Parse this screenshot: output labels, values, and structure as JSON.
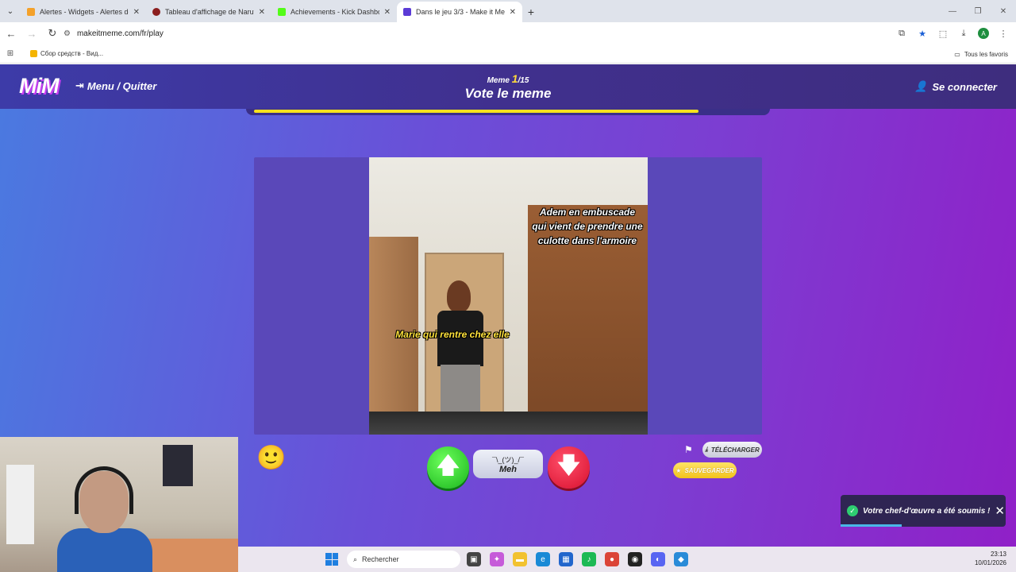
{
  "browser": {
    "tabs": [
      {
        "label": "Alertes - Widgets - Alertes de d",
        "favicon_color": "#f4a12a",
        "active": false
      },
      {
        "label": "Tableau d'affichage de Naruto",
        "favicon_color": "#8b1e1e",
        "active": false
      },
      {
        "label": "Achievements - Kick Dashboard",
        "favicon_color": "#53fc18",
        "active": false
      },
      {
        "label": "Dans le jeu 3/3 - Make it Meme",
        "favicon_color": "#5b3bd6",
        "active": true
      }
    ],
    "new_tab": "+",
    "url": "makeitmeme.com/fr/play",
    "profile_initial": "A",
    "bookmark": "Сбор средств - Вид...",
    "all_bookmarks": "Tous les favoris"
  },
  "header": {
    "logo": "MiM",
    "menu_label": "Menu / Quitter",
    "meme_word": "Meme",
    "meme_current": "1",
    "meme_total": "/15",
    "title": "Vote le meme",
    "login_label": "Se connecter",
    "progress": 0.875
  },
  "meme": {
    "caption_top": "Adem en embuscade qui vient de prendre une culotte dans l'armoire",
    "caption_mid": "Marie qui rentre chez elle"
  },
  "controls": {
    "emoji": "🙂",
    "up_arrow": "🡅",
    "meh_shrug": "¯\\_(ツ)_/¯",
    "meh_label": "Meh",
    "down_arrow": "🡇",
    "download_label": "TÉLÉCHARGER",
    "save_label": "SAUVEGARDER"
  },
  "toast": {
    "message": "Votre chef-d'œuvre a été soumis !",
    "close": "✕",
    "progress": 0.37
  },
  "taskbar": {
    "search_placeholder": "Rechercher",
    "time": "23:13",
    "date": "10/01/2026"
  },
  "colors": {
    "accent_yellow": "#f7e21e",
    "vote_up": "#19b51c",
    "vote_down": "#d8102e"
  }
}
